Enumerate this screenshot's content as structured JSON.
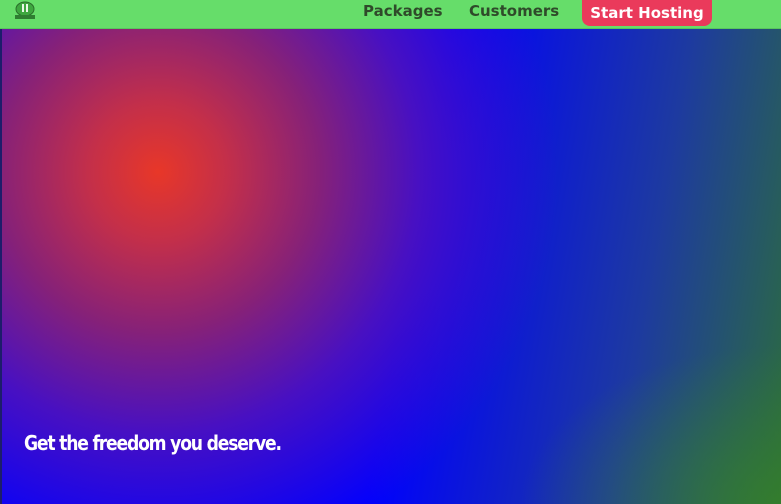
{
  "nav": {
    "links": [
      {
        "label": "Packages"
      },
      {
        "label": "Customers"
      }
    ],
    "cta_label": "Start Hosting",
    "logo_icon": "leaf-logo-icon"
  },
  "hero": {
    "tagline": "Get the freedom you deserve."
  },
  "colors": {
    "navbar": "#66dd6a",
    "cta": "#ea3a5b",
    "nav_text": "#2f4a2a",
    "hero_blue": "#0000ff",
    "hero_red": "#e83728",
    "hero_green": "#2c6d3c"
  }
}
